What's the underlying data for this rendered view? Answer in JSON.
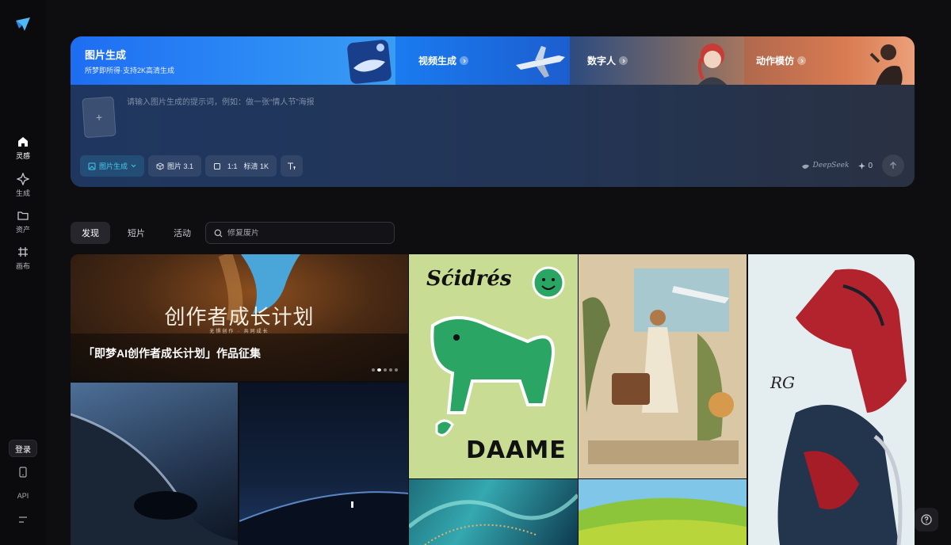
{
  "sidebar": {
    "items": [
      {
        "label": "灵感",
        "icon": "home-icon"
      },
      {
        "label": "生成",
        "icon": "sparkle-icon"
      },
      {
        "label": "资产",
        "icon": "folder-icon"
      },
      {
        "label": "画布",
        "icon": "canvas-icon"
      }
    ],
    "login_label": "登录",
    "api_label": "API"
  },
  "banner": {
    "title": "图片生成",
    "subtitle": "所梦即所得·支持2K高清生成",
    "segments": [
      {
        "label": "视频生成"
      },
      {
        "label": "数字人"
      },
      {
        "label": "动作模仿"
      }
    ]
  },
  "prompt": {
    "placeholder": "请输入图片生成的提示词，例如：做一张“情人节”海报",
    "mode_label": "图片生成",
    "model_label": "图片 3.1",
    "ratio_label": "1:1",
    "quality_label": "标清 1K",
    "deepseek_label": "DeepSeek",
    "credit": "0"
  },
  "tabs": [
    {
      "label": "发现",
      "active": true
    },
    {
      "label": "短片",
      "active": false
    },
    {
      "label": "活动",
      "active": false
    }
  ],
  "search": {
    "placeholder": "修复废片"
  },
  "feature": {
    "title": "创作者成长计划",
    "tagline": "无惧创作 · 共同成长",
    "caption": "「即梦AI创作者成长计划」作品征集"
  },
  "gallery_text": {
    "sticker_top": "Sćidrés",
    "sticker_bottom": "DAAME",
    "robot_signature": "RG"
  },
  "colors": {
    "accent": "#43c9ef",
    "banner_blue": "#1e6df2",
    "sticker_green": "#2aa563"
  }
}
